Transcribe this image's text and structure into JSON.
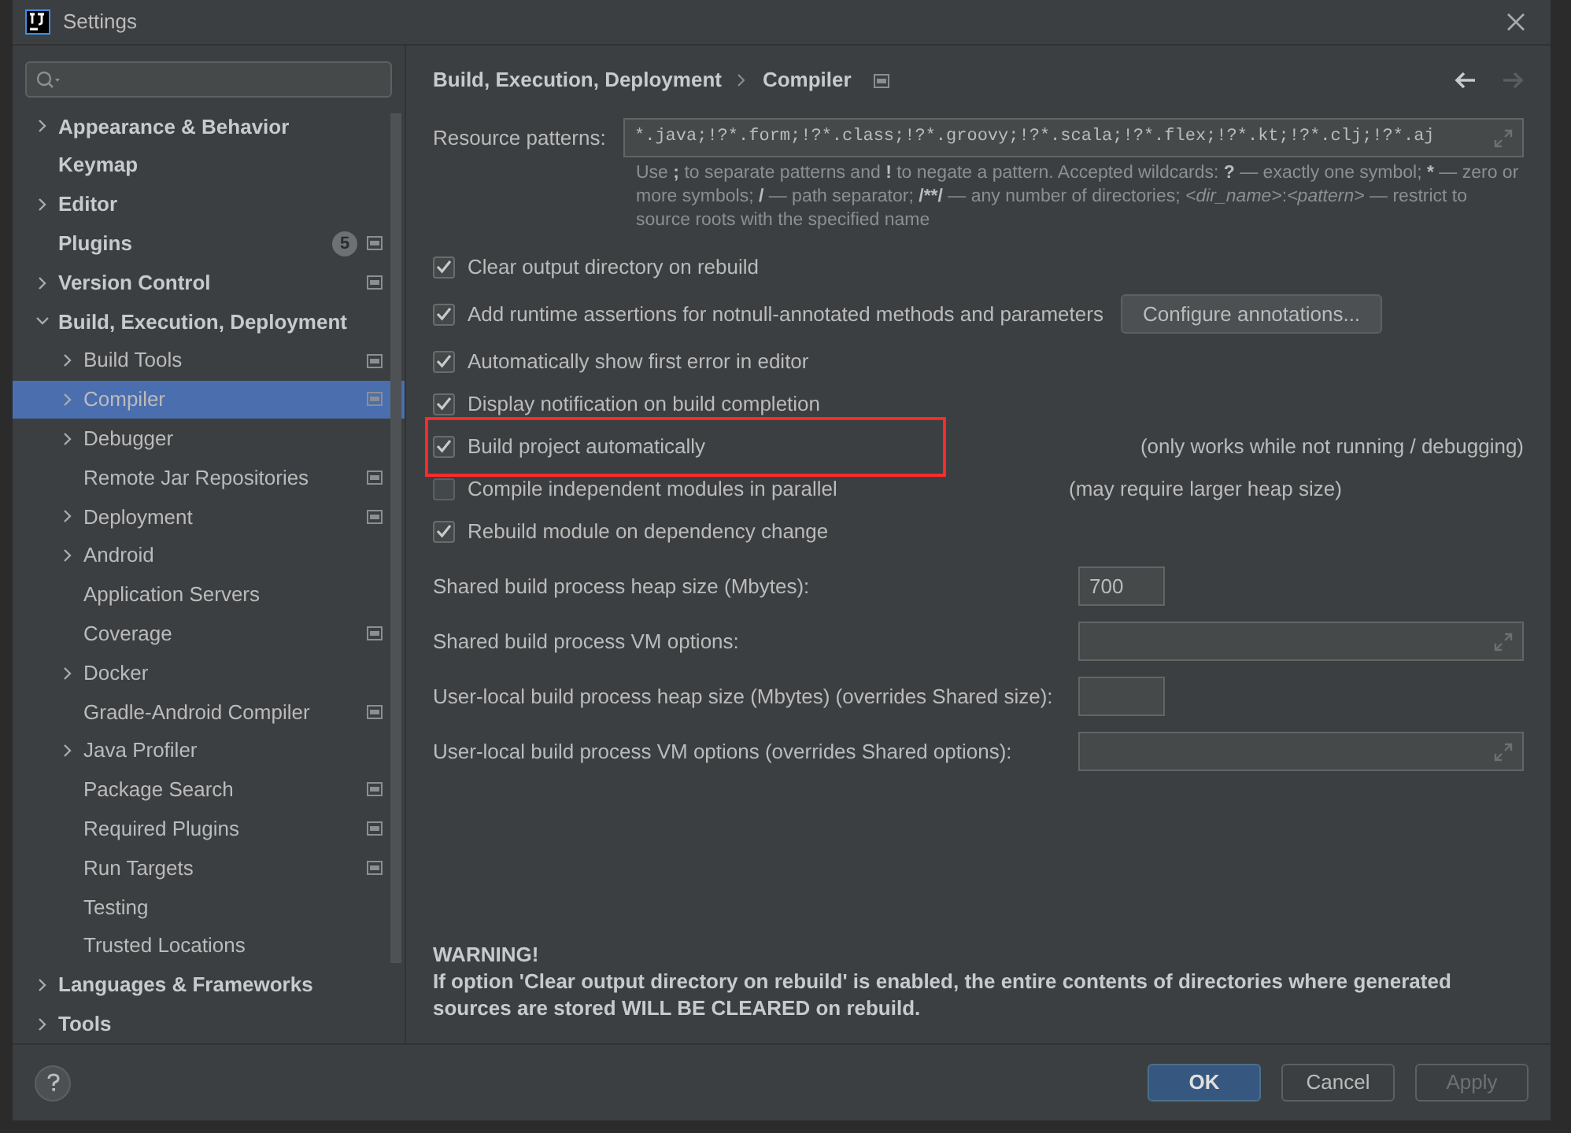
{
  "window": {
    "title": "Settings"
  },
  "tree": [
    {
      "label": "Appearance & Behavior",
      "kind": "branch",
      "expanded": false,
      "selected": false,
      "project_icon": false
    },
    {
      "label": "Keymap",
      "kind": "leaf",
      "selected": false,
      "project_icon": false
    },
    {
      "label": "Editor",
      "kind": "branch",
      "expanded": false,
      "selected": false,
      "project_icon": false
    },
    {
      "label": "Plugins",
      "kind": "leaf",
      "selected": false,
      "project_icon": true,
      "badge": "5"
    },
    {
      "label": "Version Control",
      "kind": "branch",
      "expanded": false,
      "selected": false,
      "project_icon": true
    },
    {
      "label": "Build, Execution, Deployment",
      "kind": "branch",
      "expanded": true,
      "selected": false,
      "project_icon": false,
      "children": [
        {
          "label": "Build Tools",
          "kind": "branch",
          "expanded": false,
          "selected": false,
          "project_icon": true
        },
        {
          "label": "Compiler",
          "kind": "branch",
          "expanded": false,
          "selected": true,
          "project_icon": true
        },
        {
          "label": "Debugger",
          "kind": "branch",
          "expanded": false,
          "selected": false,
          "project_icon": false
        },
        {
          "label": "Remote Jar Repositories",
          "kind": "leaf",
          "selected": false,
          "project_icon": true
        },
        {
          "label": "Deployment",
          "kind": "branch",
          "expanded": false,
          "selected": false,
          "project_icon": true
        },
        {
          "label": "Android",
          "kind": "branch",
          "expanded": false,
          "selected": false,
          "project_icon": false
        },
        {
          "label": "Application Servers",
          "kind": "leaf",
          "selected": false,
          "project_icon": false
        },
        {
          "label": "Coverage",
          "kind": "leaf",
          "selected": false,
          "project_icon": true
        },
        {
          "label": "Docker",
          "kind": "branch",
          "expanded": false,
          "selected": false,
          "project_icon": false
        },
        {
          "label": "Gradle-Android Compiler",
          "kind": "leaf",
          "selected": false,
          "project_icon": true
        },
        {
          "label": "Java Profiler",
          "kind": "branch",
          "expanded": false,
          "selected": false,
          "project_icon": false
        },
        {
          "label": "Package Search",
          "kind": "leaf",
          "selected": false,
          "project_icon": true
        },
        {
          "label": "Required Plugins",
          "kind": "leaf",
          "selected": false,
          "project_icon": true
        },
        {
          "label": "Run Targets",
          "kind": "leaf",
          "selected": false,
          "project_icon": true
        },
        {
          "label": "Testing",
          "kind": "leaf",
          "selected": false,
          "project_icon": false
        },
        {
          "label": "Trusted Locations",
          "kind": "leaf",
          "selected": false,
          "project_icon": false
        }
      ]
    },
    {
      "label": "Languages & Frameworks",
      "kind": "branch",
      "expanded": false,
      "selected": false,
      "project_icon": false
    },
    {
      "label": "Tools",
      "kind": "branch",
      "expanded": false,
      "selected": false,
      "project_icon": false
    }
  ],
  "breadcrumb": [
    "Build, Execution, Deployment",
    "Compiler"
  ],
  "resource_patterns": {
    "label": "Resource patterns:",
    "value": "*.java;!?*.form;!?*.class;!?*.groovy;!?*.scala;!?*.flex;!?*.kt;!?*.clj;!?*.aj",
    "hint": [
      {
        "text": "Use ",
        "kind": "plain"
      },
      {
        "text": ";",
        "kind": "symbol"
      },
      {
        "text": " to separate patterns and ",
        "kind": "plain"
      },
      {
        "text": "!",
        "kind": "symbol"
      },
      {
        "text": " to negate a pattern. Accepted wildcards: ",
        "kind": "plain"
      },
      {
        "text": "?",
        "kind": "symbol"
      },
      {
        "text": " — exactly one symbol; ",
        "kind": "plain"
      },
      {
        "text": "*",
        "kind": "symbol"
      },
      {
        "text": " — zero or more symbols; ",
        "kind": "plain"
      },
      {
        "text": "/",
        "kind": "symbol"
      },
      {
        "text": " — path separator; ",
        "kind": "plain"
      },
      {
        "text": "/**/",
        "kind": "symbol"
      },
      {
        "text": " — any number of directories; ",
        "kind": "plain"
      },
      {
        "text": "<dir_name>",
        "kind": "variable"
      },
      {
        "text": ":",
        "kind": "plain"
      },
      {
        "text": "<pattern>",
        "kind": "variable"
      },
      {
        "text": " — restrict to source roots with the specified name",
        "kind": "plain"
      }
    ]
  },
  "options": [
    {
      "label": "Clear output directory on rebuild",
      "checked": true,
      "highlighted": false
    },
    {
      "label": "Add runtime assertions for notnull-annotated methods and parameters",
      "checked": true,
      "highlighted": false,
      "button": "Configure annotations..."
    },
    {
      "label": "Automatically show first error in editor",
      "checked": true,
      "highlighted": false
    },
    {
      "label": "Display notification on build completion",
      "checked": true,
      "highlighted": false
    },
    {
      "label": "Build project automatically",
      "checked": true,
      "highlighted": true,
      "note": "(only works while not running / debugging)"
    },
    {
      "label": "Compile independent modules in parallel",
      "checked": false,
      "highlighted": false,
      "note": "(may require larger heap size)"
    },
    {
      "label": "Rebuild module on dependency change",
      "checked": true,
      "highlighted": false
    }
  ],
  "fields": [
    {
      "label": "Shared build process heap size (Mbytes):",
      "kind": "short",
      "value": "700"
    },
    {
      "label": "Shared build process VM options:",
      "kind": "expandable"
    },
    {
      "label": "User-local build process heap size (Mbytes) (overrides Shared size):",
      "kind": "short"
    },
    {
      "label": "User-local build process VM options (overrides Shared options):",
      "kind": "expandable"
    }
  ],
  "warning": {
    "title": "WARNING!",
    "text": "If option 'Clear output directory on rebuild' is enabled, the entire contents of directories where generated sources are stored WILL BE CLEARED on rebuild."
  },
  "buttons": [
    {
      "label": "OK",
      "kind": "primary",
      "disabled": false
    },
    {
      "label": "Cancel",
      "kind": "normal",
      "disabled": false
    },
    {
      "label": "Apply",
      "kind": "normal",
      "disabled": true
    }
  ]
}
